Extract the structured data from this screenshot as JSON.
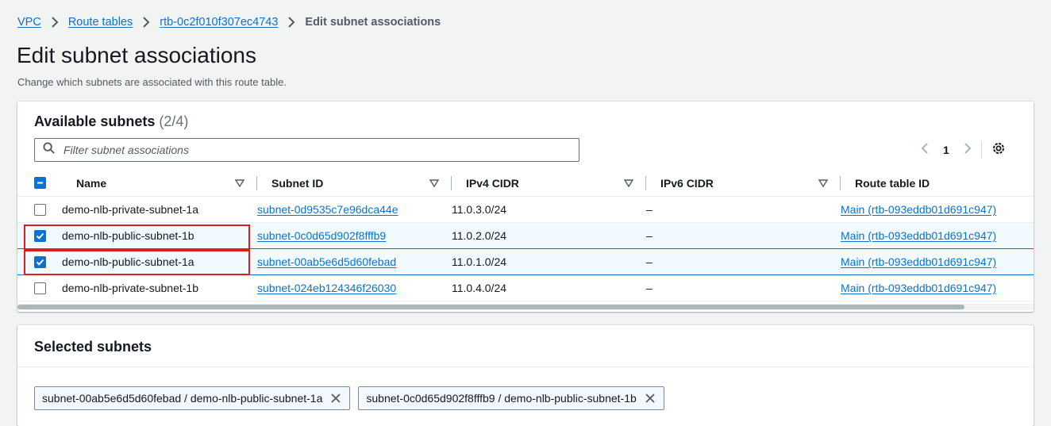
{
  "breadcrumb": [
    {
      "label": "VPC"
    },
    {
      "label": "Route tables"
    },
    {
      "label": "rtb-0c2f010f307ec4743"
    },
    {
      "label": "Edit subnet associations"
    }
  ],
  "page": {
    "title": "Edit subnet associations",
    "description": "Change which subnets are associated with this route table."
  },
  "available": {
    "title": "Available subnets",
    "count": "(2/4)",
    "filter_placeholder": "Filter subnet associations",
    "page_number": "1",
    "columns": [
      "Name",
      "Subnet ID",
      "IPv4 CIDR",
      "IPv6 CIDR",
      "Route table ID"
    ],
    "rows": [
      {
        "selected": false,
        "name": "demo-nlb-private-subnet-1a",
        "subnet_id": "subnet-0d9535c7e96dca44e",
        "ipv4": "11.0.3.0/24",
        "ipv6": "–",
        "route_table": "Main (rtb-093eddb01d691c947)"
      },
      {
        "selected": true,
        "name": "demo-nlb-public-subnet-1b",
        "subnet_id": "subnet-0c0d65d902f8fffb9",
        "ipv4": "11.0.2.0/24",
        "ipv6": "–",
        "route_table": "Main (rtb-093eddb01d691c947)"
      },
      {
        "selected": true,
        "name": "demo-nlb-public-subnet-1a",
        "subnet_id": "subnet-00ab5e6d5d60febad",
        "ipv4": "11.0.1.0/24",
        "ipv6": "–",
        "route_table": "Main (rtb-093eddb01d691c947)"
      },
      {
        "selected": false,
        "name": "demo-nlb-private-subnet-1b",
        "subnet_id": "subnet-024eb124346f26030",
        "ipv4": "11.0.4.0/24",
        "ipv6": "–",
        "route_table": "Main (rtb-093eddb01d691c947)"
      }
    ]
  },
  "selected": {
    "title": "Selected subnets",
    "tokens": [
      {
        "label": "subnet-00ab5e6d5d60febad / demo-nlb-public-subnet-1a"
      },
      {
        "label": "subnet-0c0d65d902f8fffb9 / demo-nlb-public-subnet-1b"
      }
    ]
  },
  "colors": {
    "link": "#0972d3",
    "highlight": "#d9201c",
    "selected_row_bg": "#f1faff"
  }
}
